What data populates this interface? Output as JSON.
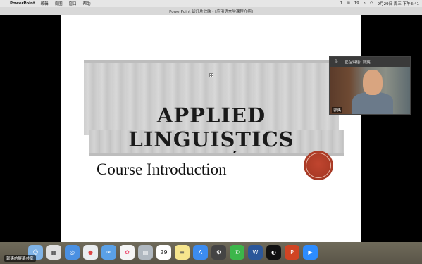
{
  "menubar": {
    "apple": "",
    "app_name": "PowerPoint",
    "menus": [
      "编辑",
      "视图",
      "窗口",
      "帮助"
    ],
    "status": {
      "badge": "1",
      "wechat_count": "19",
      "datetime": "9月29日 周三 下午3:41"
    }
  },
  "window": {
    "title": "PowerPoint 幻灯片放映 - [应用语言学课程介绍]"
  },
  "slide": {
    "title": "APPLIED LINGUISTICS",
    "subtitle": "Course Introduction"
  },
  "zoom": {
    "speaking_label": "正在讲话: 郭夷;",
    "name_tag": "郭夷"
  },
  "dock": {
    "calendar_day": "29",
    "ps_badge": "1",
    "wechat_badge": "19",
    "word_letter": "W",
    "share_label": "郭夷的屏幕共享"
  }
}
